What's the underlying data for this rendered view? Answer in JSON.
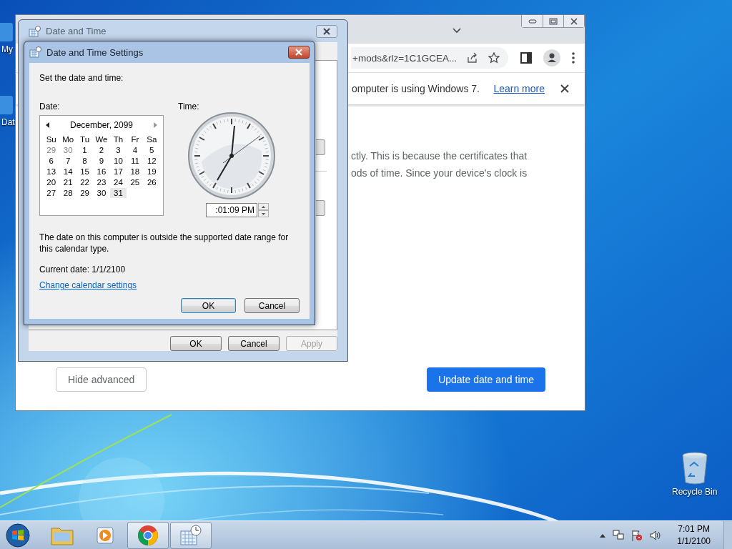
{
  "desktop_icons": [
    {
      "label": "My"
    },
    {
      "label": "Dat"
    }
  ],
  "recycle_bin": {
    "label": "Recycle Bin"
  },
  "browser": {
    "address": "+mods&rlz=1C1GCEA...",
    "infobar": {
      "text": "omputer is using Windows 7.",
      "link": "Learn more"
    },
    "body_lines": [
      "ctly. This is because the certificates that",
      "ods of time. Since your device's clock is"
    ],
    "buttons": [
      {
        "label": "Hide advanced",
        "kind": "secondary"
      },
      {
        "label": "Update date and time",
        "kind": "primary"
      }
    ]
  },
  "date_time_window": {
    "title": "Date and Time",
    "buttons": [
      {
        "label": "OK",
        "disabled": false
      },
      {
        "label": "Cancel",
        "disabled": false
      },
      {
        "label": "Apply",
        "disabled": true
      }
    ]
  },
  "settings_dialog": {
    "title": "Date and Time Settings",
    "heading": "Set the date and time:",
    "date_label": "Date:",
    "time_label": "Time:",
    "calendar": {
      "month": "December, 2099",
      "weekdays": [
        "Su",
        "Mo",
        "Tu",
        "We",
        "Th",
        "Fr",
        "Sa"
      ],
      "days": [
        {
          "label": "29",
          "other_month": true,
          "selected": false
        },
        {
          "label": "30",
          "other_month": true,
          "selected": false
        },
        {
          "label": "1",
          "other_month": false,
          "selected": false
        },
        {
          "label": "2",
          "other_month": false,
          "selected": false
        },
        {
          "label": "3",
          "other_month": false,
          "selected": false
        },
        {
          "label": "4",
          "other_month": false,
          "selected": false
        },
        {
          "label": "5",
          "other_month": false,
          "selected": false
        },
        {
          "label": "6",
          "other_month": false,
          "selected": false
        },
        {
          "label": "7",
          "other_month": false,
          "selected": false
        },
        {
          "label": "8",
          "other_month": false,
          "selected": false
        },
        {
          "label": "9",
          "other_month": false,
          "selected": false
        },
        {
          "label": "10",
          "other_month": false,
          "selected": false
        },
        {
          "label": "11",
          "other_month": false,
          "selected": false
        },
        {
          "label": "12",
          "other_month": false,
          "selected": false
        },
        {
          "label": "13",
          "other_month": false,
          "selected": false
        },
        {
          "label": "14",
          "other_month": false,
          "selected": false
        },
        {
          "label": "15",
          "other_month": false,
          "selected": false
        },
        {
          "label": "16",
          "other_month": false,
          "selected": false
        },
        {
          "label": "17",
          "other_month": false,
          "selected": false
        },
        {
          "label": "18",
          "other_month": false,
          "selected": false
        },
        {
          "label": "19",
          "other_month": false,
          "selected": false
        },
        {
          "label": "20",
          "other_month": false,
          "selected": false
        },
        {
          "label": "21",
          "other_month": false,
          "selected": false
        },
        {
          "label": "22",
          "other_month": false,
          "selected": false
        },
        {
          "label": "23",
          "other_month": false,
          "selected": false
        },
        {
          "label": "24",
          "other_month": false,
          "selected": false
        },
        {
          "label": "25",
          "other_month": false,
          "selected": false
        },
        {
          "label": "26",
          "other_month": false,
          "selected": false
        },
        {
          "label": "27",
          "other_month": false,
          "selected": false
        },
        {
          "label": "28",
          "other_month": false,
          "selected": false
        },
        {
          "label": "29",
          "other_month": false,
          "selected": false
        },
        {
          "label": "30",
          "other_month": false,
          "selected": false
        },
        {
          "label": "31",
          "other_month": false,
          "selected": true
        }
      ]
    },
    "time_value": ":01:09 PM",
    "message": "The date on this computer is outside the supported date range for this calendar type.",
    "current_date": "Current date: 1/1/2100",
    "link": "Change calendar settings",
    "buttons": [
      {
        "label": "OK",
        "default": true
      },
      {
        "label": "Cancel",
        "default": false
      }
    ]
  },
  "taskbar": {
    "items": [
      {
        "kind": "folder",
        "running": false
      },
      {
        "kind": "media",
        "running": false
      },
      {
        "kind": "chrome",
        "running": true
      },
      {
        "kind": "clock",
        "running": true
      }
    ],
    "tray": {
      "time": "7:01 PM",
      "date": "1/1/2100"
    }
  }
}
